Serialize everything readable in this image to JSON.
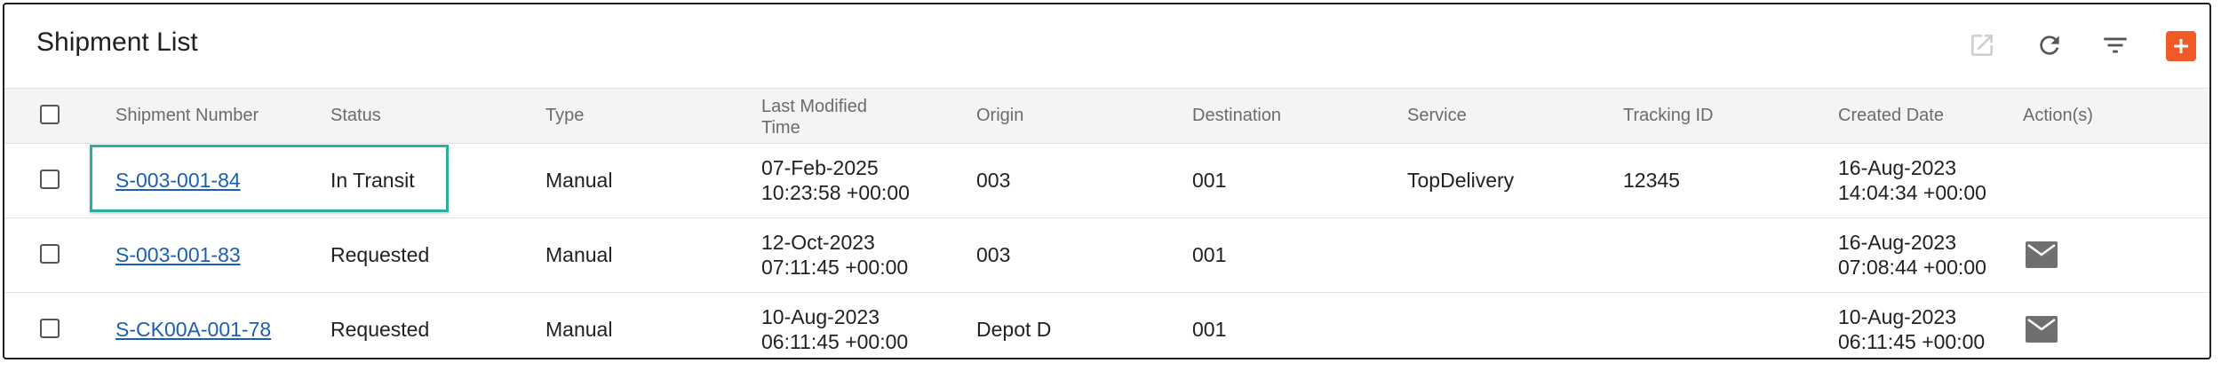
{
  "header": {
    "title": "Shipment List",
    "icons": [
      "open-in-new-icon",
      "refresh-icon",
      "filter-icon",
      "add-icon"
    ],
    "accent_color": "#f05a28"
  },
  "table": {
    "columns": {
      "shipment_number": "Shipment Number",
      "status": "Status",
      "type": "Type",
      "last_modified_line1": "Last Modified",
      "last_modified_line2": "Time",
      "origin": "Origin",
      "destination": "Destination",
      "service": "Service",
      "tracking_id": "Tracking ID",
      "created_date": "Created Date",
      "actions": "Action(s)"
    },
    "rows": [
      {
        "shipment_number": "S-003-001-84",
        "status": "In Transit",
        "type": "Manual",
        "modified_date": "07-Feb-2025",
        "modified_time": "10:23:58 +00:00",
        "origin": "003",
        "destination": "001",
        "service": "TopDelivery",
        "tracking_id": "12345",
        "created_date": "16-Aug-2023",
        "created_time": "14:04:34 +00:00",
        "action_icon": ""
      },
      {
        "shipment_number": "S-003-001-83",
        "status": "Requested",
        "type": "Manual",
        "modified_date": "12-Oct-2023",
        "modified_time": "07:11:45 +00:00",
        "origin": "003",
        "destination": "001",
        "service": "",
        "tracking_id": "",
        "created_date": "16-Aug-2023",
        "created_time": "07:08:44 +00:00",
        "action_icon": "mail-icon"
      },
      {
        "shipment_number": "S-CK00A-001-78",
        "status": "Requested",
        "type": "Manual",
        "modified_date": "10-Aug-2023",
        "modified_time": "06:11:45 +00:00",
        "origin": "Depot D",
        "destination": "001",
        "service": "",
        "tracking_id": "",
        "created_date": "10-Aug-2023",
        "created_time": "06:11:45 +00:00",
        "action_icon": "mail-icon"
      }
    ]
  }
}
